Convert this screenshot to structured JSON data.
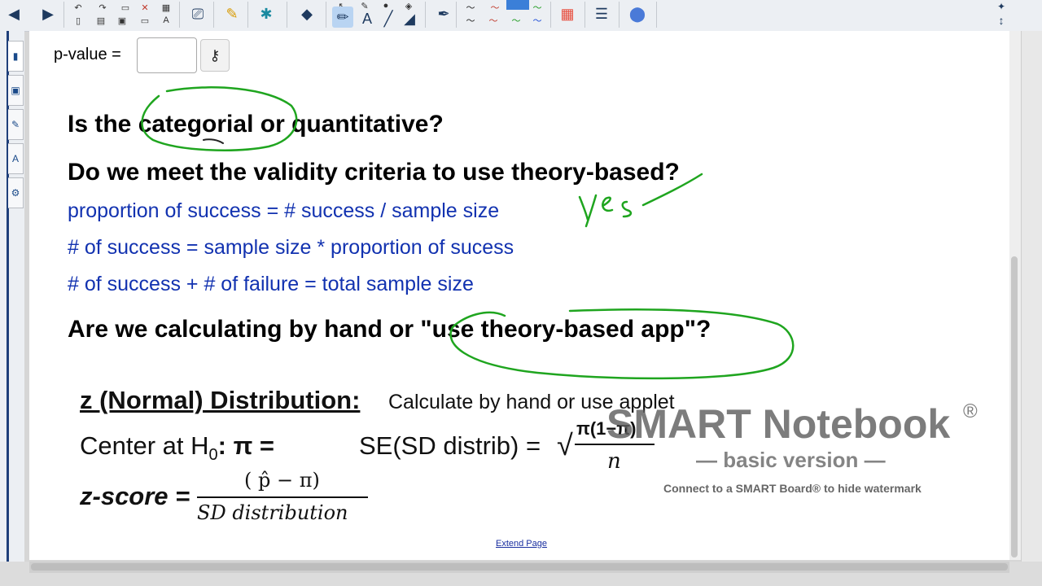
{
  "watermark": {
    "title": "SMART Notebook",
    "registered": "®",
    "subtitle": "— basic version —",
    "connect": "Connect to a SMART Board® to hide watermark"
  },
  "pvalue": {
    "label": "p-value =",
    "value": "",
    "key_icon": "key-icon"
  },
  "questions": {
    "categorical": "Is the categorial or quantitative?",
    "validity": "Do we meet the validity criteria to use theory-based?",
    "calculating": "Are we calculating by hand or \"use theory-based app\"?"
  },
  "formulas": {
    "line1": "proportion of success = # success / sample size",
    "line2": "# of success = sample size * proportion of sucess",
    "line3": "# of success + # of failure = total sample size"
  },
  "zsection": {
    "heading": "z (Normal) Distribution:",
    "subheading": "Calculate by hand or use applet",
    "center": "Center at H",
    "center_sub": "0",
    "center_tail": ": π =",
    "se": "SE(SD distrib) =",
    "se_sqrt": "√",
    "se_num": "π(1−π)",
    "se_den": "n",
    "zscore": "z-score =",
    "frac_num": "( p̂ − π)",
    "frac_den": "SD distribution"
  },
  "handwriting": {
    "yes": "yes"
  },
  "extend_page": "Extend Page",
  "colors": {
    "ink_green": "#1fa51f",
    "text_blue": "#1232b0"
  }
}
